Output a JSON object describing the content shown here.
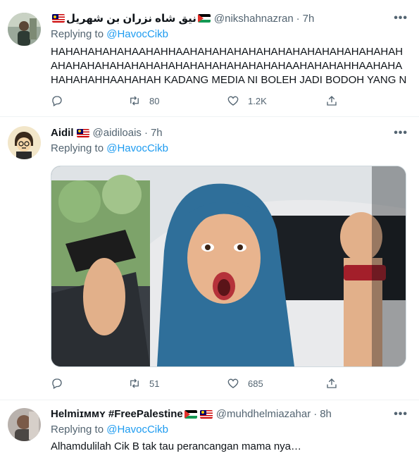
{
  "tweets": [
    {
      "name": "نيق شاه نزران بن شهريل",
      "handle": "@nikshahnazran",
      "time": "7h",
      "replying_prefix": "Replying to",
      "replying_to": "@HavocCikb",
      "text": "HAHAHAHAHAHAAHAHHAAHAHAHAHAHAHAHAHAHAHAHAHAHAHAHAHAHAHAHAHAHAHAHAHAHAHAHAHAHAHAHAAHAHAHAHHAAHAHAHAHAHAHHAAHAHAH KADANG MEDIA NI BOLEH JADI BODOH YANG NYATA .",
      "retweets": "80",
      "likes": "1.2K"
    },
    {
      "name": "Aidil",
      "handle": "@aidiloais",
      "time": "7h",
      "replying_prefix": "Replying to",
      "replying_to": "@HavocCikb",
      "retweets": "51",
      "likes": "685"
    },
    {
      "name": "Helmiɪᴍᴍʏ #FreePalestine",
      "handle": "@muhdhelmiazahar",
      "time": "8h",
      "replying_prefix": "Replying to",
      "replying_to": "@HavocCikb",
      "text": "Alhamdulilah Cik B tak tau perancangan mama nya…"
    }
  ],
  "more_glyph": "•••",
  "dot": "·",
  "colors": {
    "link": "#1d9bf0",
    "muted": "#536471"
  },
  "icons": [
    "reply-icon",
    "retweet-icon",
    "like-icon",
    "share-icon",
    "more-icon"
  ]
}
